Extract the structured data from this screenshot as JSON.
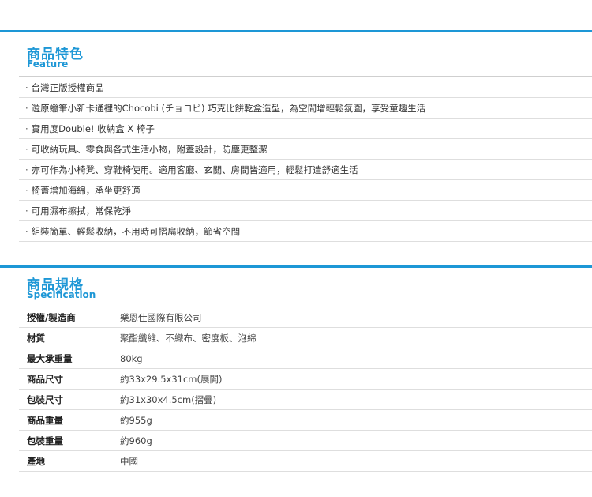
{
  "feature": {
    "title_zh": "商品特色",
    "title_en": "Feature",
    "items": [
      "台灣正版授權商品",
      "還原蠟筆小新卡通裡的Chocobi (チョコビ) 巧克比餅乾盒造型，為空間增輕鬆氛圍，享受童趣生活",
      "實用度Double! 收納盒 X 椅子",
      "可收納玩具、零食與各式生活小物，附蓋設計，防塵更整潔",
      "亦可作為小椅凳、穿鞋椅使用。適用客廳、玄關、房間皆適用，輕鬆打造舒適生活",
      "椅蓋增加海綿，承坐更舒適",
      "可用濕布擦拭，常保乾淨",
      "組裝簡單、輕鬆收納，不用時可摺扁收納，節省空間"
    ]
  },
  "spec": {
    "title_zh": "商品規格",
    "title_en": "Specification",
    "rows": [
      {
        "key": "授權/製造商",
        "value": "樂恩仕國際有限公司"
      },
      {
        "key": "材質",
        "value": "聚酯纖維、不織布、密度板、泡綿"
      },
      {
        "key": "最大承重量",
        "value": "80kg"
      },
      {
        "key": "商品尺寸",
        "value": "約33x29.5x31cm(展開)"
      },
      {
        "key": "包裝尺寸",
        "value": "約31x30x4.5cm(摺疊)"
      },
      {
        "key": "商品重量",
        "value": "約955g"
      },
      {
        "key": "包裝重量",
        "value": "約960g"
      },
      {
        "key": "產地",
        "value": "中國"
      }
    ]
  },
  "colors": {
    "accent": "#1d97d6"
  }
}
